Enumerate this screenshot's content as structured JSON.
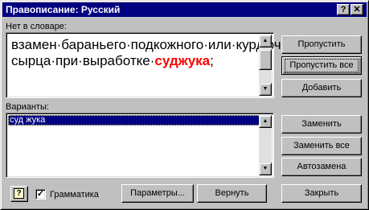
{
  "window": {
    "title": "Правописание: Русский",
    "help_glyph": "?",
    "close_glyph": "✕"
  },
  "not_in_dictionary": {
    "label": "Нет в словаре:",
    "text_before": "взамен·бараньего·подкожного·или·курдючного·жира-сырца·при·выработке·",
    "error_word": "суджука",
    "text_after": ";"
  },
  "suggestions": {
    "label": "Варианты:",
    "items": [
      "суд жука"
    ]
  },
  "buttons": {
    "ignore": "Пропустить",
    "ignore_all": "Пропустить все",
    "add": "Добавить",
    "change": "Заменить",
    "change_all": "Заменить все",
    "autocorrect": "Автозамена",
    "options": "Параметры...",
    "undo": "Вернуть",
    "close": "Закрыть"
  },
  "grammar_checkbox": {
    "label": "Грамматика",
    "checked": true,
    "check_glyph": "✓"
  },
  "help_button": {
    "glyph": "?"
  },
  "scroll_glyphs": {
    "up": "▲",
    "down": "▼"
  }
}
